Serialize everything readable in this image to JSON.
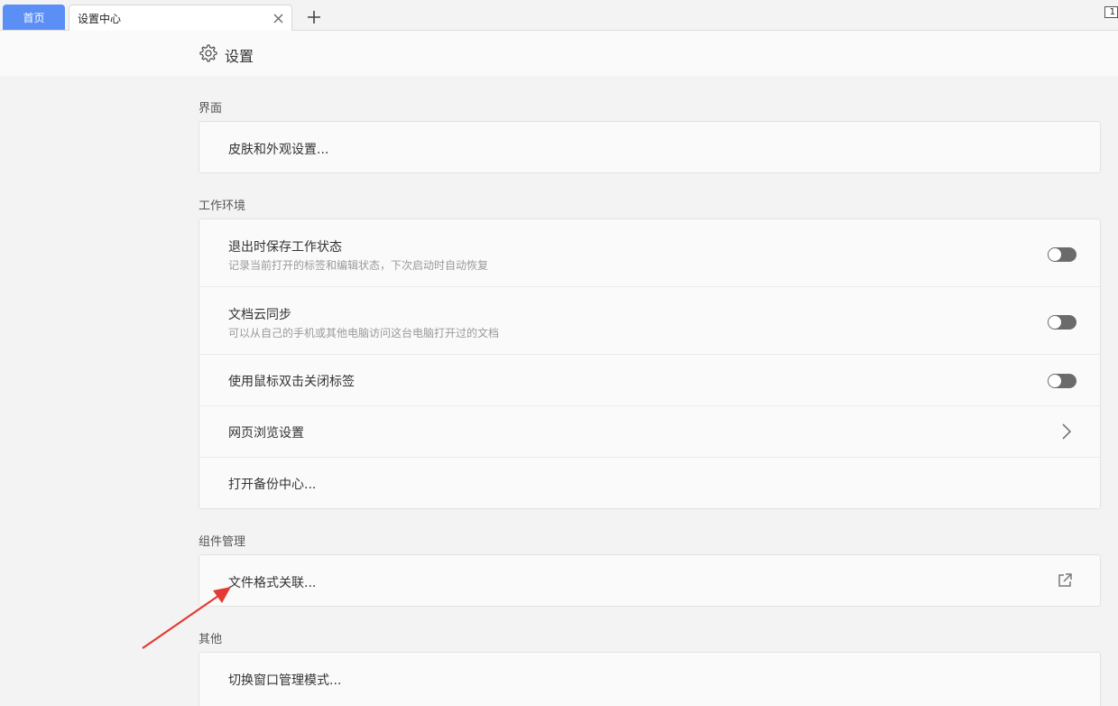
{
  "tabs": {
    "home": "首页",
    "active": "设置中心",
    "badge": "1"
  },
  "header": {
    "title": "设置"
  },
  "sections": {
    "interface": {
      "title": "界面",
      "skin": "皮肤和外观设置..."
    },
    "workspace": {
      "title": "工作环境",
      "save_state": {
        "label": "退出时保存工作状态",
        "desc": "记录当前打开的标签和编辑状态，下次启动时自动恢复",
        "enabled": false
      },
      "cloud_sync": {
        "label": "文档云同步",
        "desc": "可以从自己的手机或其他电脑访问这台电脑打开过的文档",
        "enabled": false
      },
      "dblclick_close": {
        "label": "使用鼠标双击关闭标签",
        "enabled": false
      },
      "web_browse": {
        "label": "网页浏览设置"
      },
      "backup": {
        "label": "打开备份中心..."
      }
    },
    "components": {
      "title": "组件管理",
      "file_assoc": "文件格式关联..."
    },
    "other": {
      "title": "其他",
      "window_mode": "切换窗口管理模式..."
    }
  },
  "colors": {
    "accent": "#5b8ff5",
    "annotation_arrow": "#e53935",
    "toggle_off": "#6b6b6b"
  }
}
